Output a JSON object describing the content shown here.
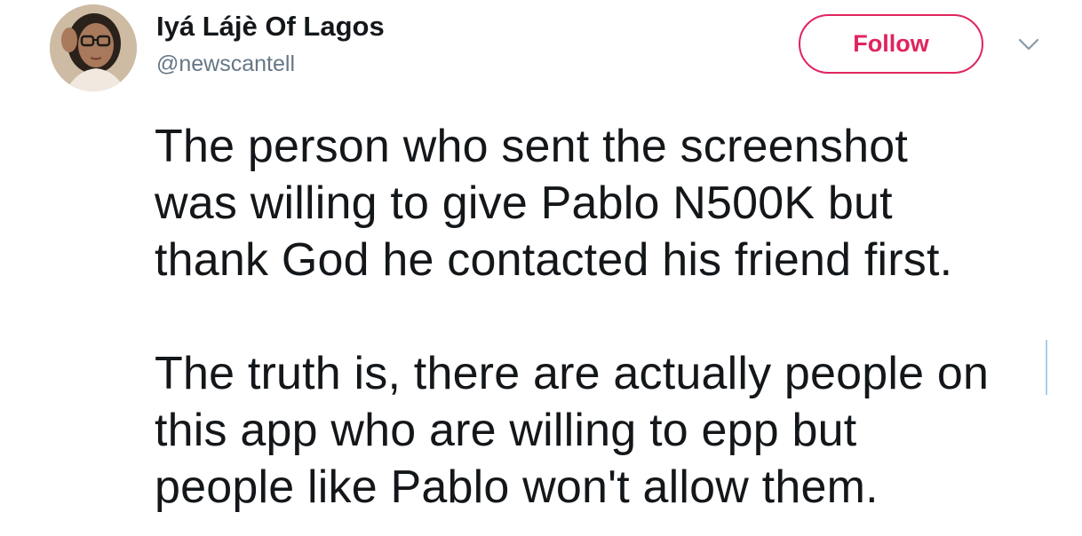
{
  "user": {
    "display_name": "Iyá Lájè Of Lagos",
    "handle": "@newscantell",
    "avatar_icon": "profile-photo-icon"
  },
  "actions": {
    "follow_label": "Follow",
    "menu_icon": "chevron-down-icon"
  },
  "tweet": {
    "lines": [
      "The person who sent the screenshot",
      "was willing to give Pablo N500K but",
      "thank God he contacted his friend first.",
      "",
      "The truth is, there are actually people on",
      "this app who are willing to epp but",
      "people like Pablo won't allow them."
    ]
  },
  "colors": {
    "accent": "#e0245e",
    "text": "#14171a",
    "secondary": "#657786"
  }
}
